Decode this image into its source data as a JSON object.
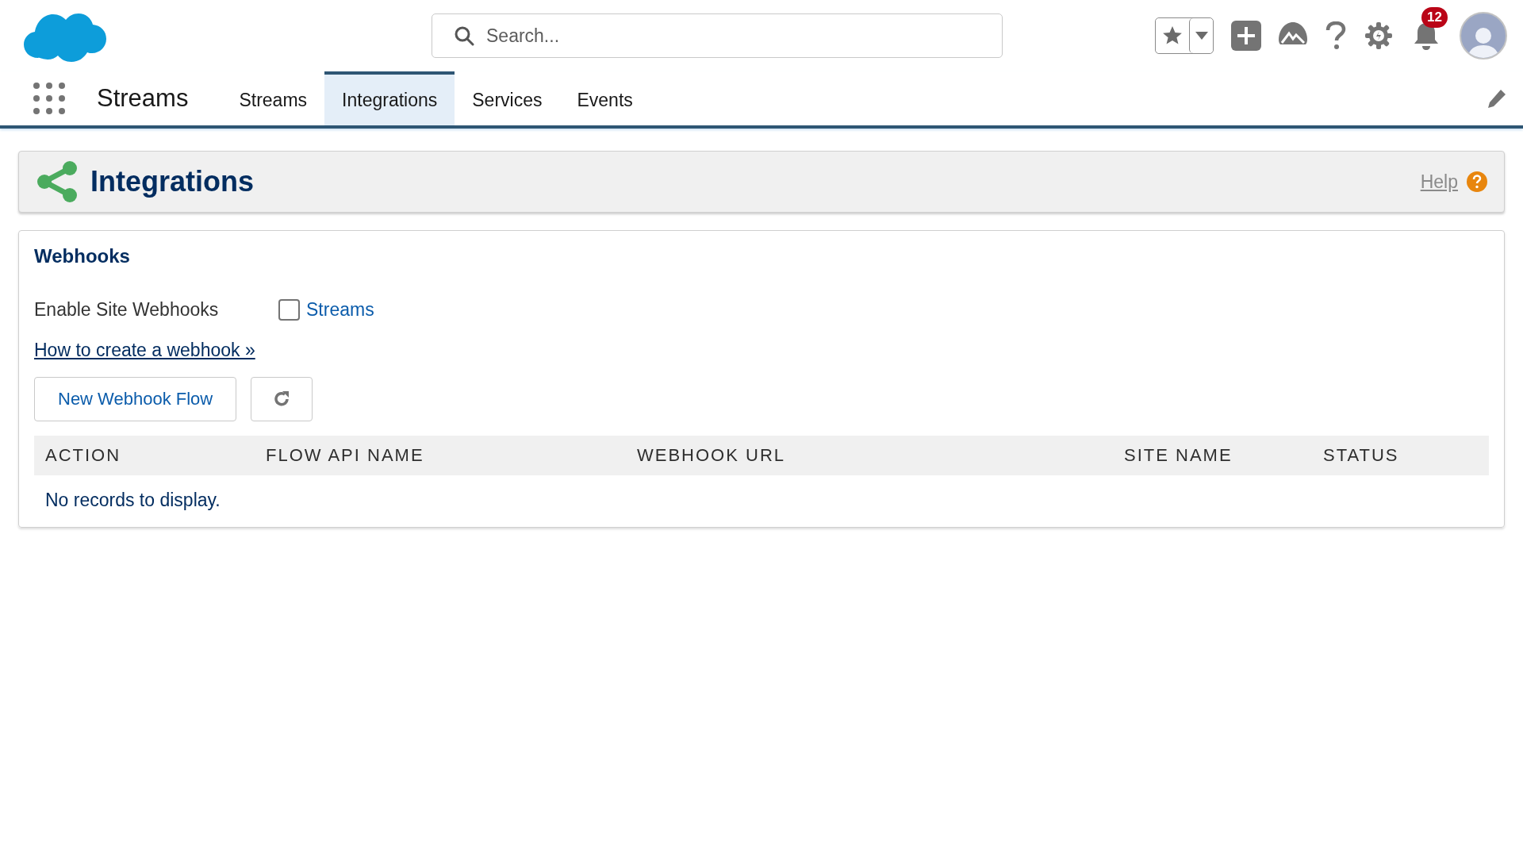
{
  "header": {
    "search": {
      "placeholder": "Search..."
    },
    "notifications": {
      "count": "12"
    }
  },
  "nav": {
    "app_name": "Streams",
    "tabs": [
      {
        "label": "Streams",
        "selected": false
      },
      {
        "label": "Integrations",
        "selected": true
      },
      {
        "label": "Services",
        "selected": false
      },
      {
        "label": "Events",
        "selected": false
      }
    ]
  },
  "page_header": {
    "title": "Integrations",
    "help": "Help"
  },
  "webhooks": {
    "title": "Webhooks",
    "enable_label": "Enable Site Webhooks",
    "site_checkbox": {
      "label": "Streams",
      "checked": false
    },
    "link": "How to create a webhook »",
    "buttons": [
      {
        "kind": "text",
        "label": "New Webhook Flow"
      },
      {
        "kind": "refresh"
      }
    ],
    "table": {
      "columns": [
        "ACTION",
        "FLOW API NAME",
        "WEBHOOK URL",
        "SITE NAME",
        "STATUS"
      ],
      "empty_text": "No records to display."
    }
  }
}
